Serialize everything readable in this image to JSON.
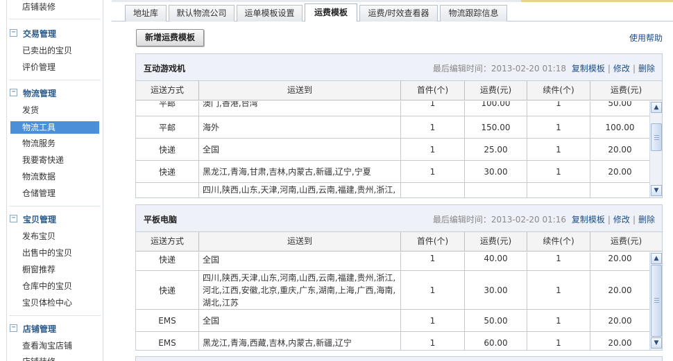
{
  "sidebar": {
    "top_link": "店铺装修",
    "sections": [
      {
        "title": "交易管理",
        "toggle": "−",
        "items": [
          "已卖出的宝贝",
          "评价管理"
        ]
      },
      {
        "title": "物流管理",
        "toggle": "−",
        "items": [
          "发货",
          "物流工具",
          "物流服务",
          "我要寄快递",
          "物流数据",
          "仓储管理"
        ]
      },
      {
        "title": "宝贝管理",
        "toggle": "−",
        "items": [
          "发布宝贝",
          "出售中的宝贝",
          "橱窗推荐",
          "仓库中的宝贝",
          "宝贝体检中心"
        ]
      },
      {
        "title": "店铺管理",
        "toggle": "−",
        "items": [
          "查看淘宝店铺",
          "店铺装修"
        ]
      }
    ],
    "active_item": "物流工具"
  },
  "tabs": [
    {
      "label": "地址库"
    },
    {
      "label": "默认物流公司"
    },
    {
      "label": "运单模板设置"
    },
    {
      "label": "运费模板"
    },
    {
      "label": "运费/时效查看器"
    },
    {
      "label": "物流跟踪信息"
    }
  ],
  "active_tab": "运费模板",
  "toolbar": {
    "new_template_label": "新增运费模板",
    "help_label": "使用帮助"
  },
  "columns": [
    "运送方式",
    "运送到",
    "首件(个)",
    "运费(元)",
    "续件(个)",
    "运费(元)"
  ],
  "actions": {
    "copy": "复制模板",
    "edit": "修改",
    "delete": "删除",
    "separator": "|"
  },
  "templates": [
    {
      "name": "互动游戏机",
      "last_edited_label": "最后编辑时间：",
      "last_edited": "2013-02-20 01:18",
      "rows": [
        {
          "method": "平邮",
          "dest": "澳门,香港,台湾",
          "first": "1",
          "fee": "100.00",
          "cont": "1",
          "cont_fee": "50.00"
        },
        {
          "method": "平邮",
          "dest": "海外",
          "first": "1",
          "fee": "150.00",
          "cont": "1",
          "cont_fee": "100.00"
        },
        {
          "method": "快递",
          "dest": "全国",
          "first": "1",
          "fee": "25.00",
          "cont": "1",
          "cont_fee": "20.00"
        },
        {
          "method": "快递",
          "dest": "黑龙江,青海,甘肃,吉林,内蒙古,新疆,辽宁,宁夏",
          "first": "1",
          "fee": "30.00",
          "cont": "1",
          "cont_fee": "20.00"
        },
        {
          "method": "快递",
          "dest": "四川,陕西,山东,天津,河南,山西,云南,福建,贵州,浙江,",
          "first": "",
          "fee": "",
          "cont": "",
          "cont_fee": ""
        }
      ]
    },
    {
      "name": "平板电脑",
      "last_edited_label": "最后编辑时间：",
      "last_edited": "2013-02-20 01:16",
      "rows": [
        {
          "method": "快递",
          "dest": "全国",
          "first": "1",
          "fee": "40.00",
          "cont": "1",
          "cont_fee": "20.00"
        },
        {
          "method": "快递",
          "dest": "四川,陕西,天津,山东,河南,山西,云南,福建,贵州,浙江,河北,江西,安徽,北京,重庆,广东,湖南,上海,广西,海南,湖北,江苏",
          "first": "1",
          "fee": "30.00",
          "cont": "1",
          "cont_fee": "20.00"
        },
        {
          "method": "EMS",
          "dest": "全国",
          "first": "1",
          "fee": "50.00",
          "cont": "1",
          "cont_fee": "20.00"
        },
        {
          "method": "EMS",
          "dest": "黑龙江,青海,西藏,吉林,内蒙古,新疆,辽宁",
          "first": "1",
          "fee": "60.00",
          "cont": "1",
          "cont_fee": "20.00"
        }
      ]
    }
  ],
  "icons": {
    "scroll_up": "▲",
    "scroll_down": "▼"
  },
  "colors": {
    "active_item_bg": "#4a8fd8",
    "link": "#1c4e8a",
    "section_title": "#2b5a8a",
    "panel_header_bg": "#eef2f8"
  }
}
